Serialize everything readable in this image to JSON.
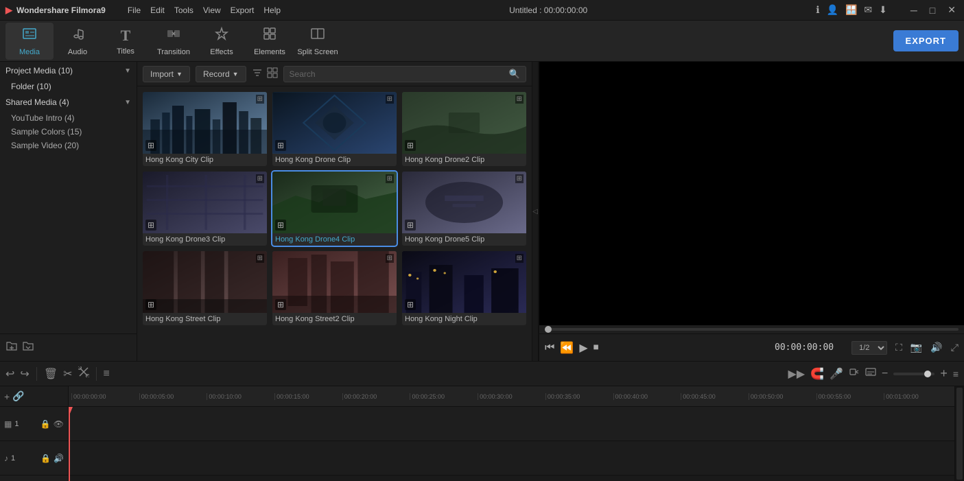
{
  "app": {
    "name": "Wondershare Filmora9",
    "title": "Untitled : 00:00:00:00"
  },
  "menu": {
    "items": [
      "File",
      "Edit",
      "Tools",
      "View",
      "Export",
      "Help"
    ]
  },
  "titlebar": {
    "icons": [
      "info",
      "user",
      "download",
      "mail",
      "arrow-down"
    ]
  },
  "toolbar": {
    "items": [
      {
        "id": "media",
        "label": "Media",
        "icon": "📁",
        "active": true
      },
      {
        "id": "audio",
        "label": "Audio",
        "icon": "🎵",
        "active": false
      },
      {
        "id": "titles",
        "label": "Titles",
        "icon": "T",
        "active": false
      },
      {
        "id": "transition",
        "label": "Transition",
        "icon": "↔",
        "active": false
      },
      {
        "id": "effects",
        "label": "Effects",
        "icon": "✦",
        "active": false
      },
      {
        "id": "elements",
        "label": "Elements",
        "icon": "◈",
        "active": false
      },
      {
        "id": "split-screen",
        "label": "Split Screen",
        "icon": "⊞",
        "active": false
      }
    ],
    "export_label": "EXPORT"
  },
  "left_panel": {
    "project_media": {
      "label": "Project Media (10)",
      "sub_items": [
        {
          "label": "Folder (10)",
          "active": true
        }
      ]
    },
    "shared_media": {
      "label": "Shared Media (4)",
      "sub_items": [
        {
          "label": "YouTube Intro (4)"
        },
        {
          "label": "Sample Colors (15)"
        },
        {
          "label": "Sample Video (20)"
        }
      ]
    }
  },
  "media_toolbar": {
    "import_label": "Import",
    "record_label": "Record",
    "search_placeholder": "Search"
  },
  "media_grid": {
    "clips": [
      {
        "id": "hk-city",
        "label": "Hong Kong City Clip",
        "selected": false,
        "color_class": "clip-hk-city"
      },
      {
        "id": "hk-drone",
        "label": "Hong Kong Drone Clip",
        "selected": false,
        "color_class": "clip-hk-drone"
      },
      {
        "id": "hk-drone2",
        "label": "Hong Kong Drone2 Clip",
        "selected": false,
        "color_class": "clip-hk-drone2"
      },
      {
        "id": "hk-drone3",
        "label": "Hong Kong Drone3 Clip",
        "selected": false,
        "color_class": "clip-hk-drone3"
      },
      {
        "id": "hk-drone4",
        "label": "Hong Kong Drone4 Clip",
        "selected": true,
        "color_class": "clip-hk-drone4"
      },
      {
        "id": "hk-drone5",
        "label": "Hong Kong Drone5 Clip",
        "selected": false,
        "color_class": "clip-hk-drone5"
      },
      {
        "id": "hk-street1",
        "label": "Hong Kong Street Clip",
        "selected": false,
        "color_class": "clip-hk-street1"
      },
      {
        "id": "hk-street2",
        "label": "Hong Kong Street2 Clip",
        "selected": false,
        "color_class": "clip-hk-street2"
      },
      {
        "id": "hk-night",
        "label": "Hong Kong Night Clip",
        "selected": false,
        "color_class": "clip-hk-night"
      }
    ]
  },
  "preview": {
    "timecode": "00:00:00:00",
    "quality": "1/2",
    "progress": 0
  },
  "timeline": {
    "ruler_marks": [
      "00:00:00:00",
      "00:00:05:00",
      "00:00:10:00",
      "00:00:15:00",
      "00:00:20:00",
      "00:00:25:00",
      "00:00:30:00",
      "00:00:35:00",
      "00:00:40:00",
      "00:00:45:00",
      "00:00:50:00",
      "00:00:55:00",
      "00:01:00:00"
    ],
    "tracks": [
      {
        "id": "video1",
        "type": "video",
        "icon": "▦",
        "name": "1",
        "lock": false,
        "visible": true
      },
      {
        "id": "audio1",
        "type": "audio",
        "icon": "♪",
        "name": "1",
        "lock": false,
        "mute": false
      }
    ]
  }
}
